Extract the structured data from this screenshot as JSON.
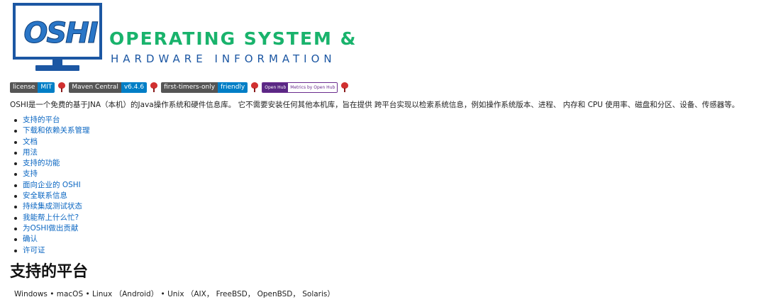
{
  "logo": {
    "screen_text": "OSHI",
    "title": "OPERATING SYSTEM &",
    "subtitle": "HARDWARE INFORMATION",
    "colors": {
      "blue": "#1c57a3",
      "green": "#19b36c"
    }
  },
  "badges": [
    {
      "left": "license",
      "right": "MIT",
      "right_color": "#007ec6"
    },
    {
      "left": "Maven Central",
      "right": "v6.4.6",
      "right_color": "#007ec6"
    },
    {
      "left": "first-timers-only",
      "right": "friendly",
      "right_color": "#007ec6"
    }
  ],
  "openhub": {
    "left": "Open Hub",
    "right": "Metrics by Open Hub"
  },
  "description": "OSHI是一个免费的基于JNA（本机）的Java操作系统和硬件信息库。 它不需要安装任何其他本机库，旨在提供 跨平台实现以检索系统信息，例如操作系统版本、进程、 内存和 CPU 使用率、磁盘和分区、设备、传感器等。",
  "toc": [
    "支持的平台",
    "下载和依赖关系管理",
    "文档",
    "用法",
    "支持的功能",
    "支持",
    "面向企业的 OSHI",
    "安全联系信息",
    "持续集成测试状态",
    "我能帮上什么忙?",
    "为OSHI做出贡献",
    "确认",
    "许可证"
  ],
  "section_heading": "支持的平台",
  "platforms": "Windows • macOS • Linux （Android） • Unix （AIX， FreeBSD， OpenBSD， Solaris）"
}
